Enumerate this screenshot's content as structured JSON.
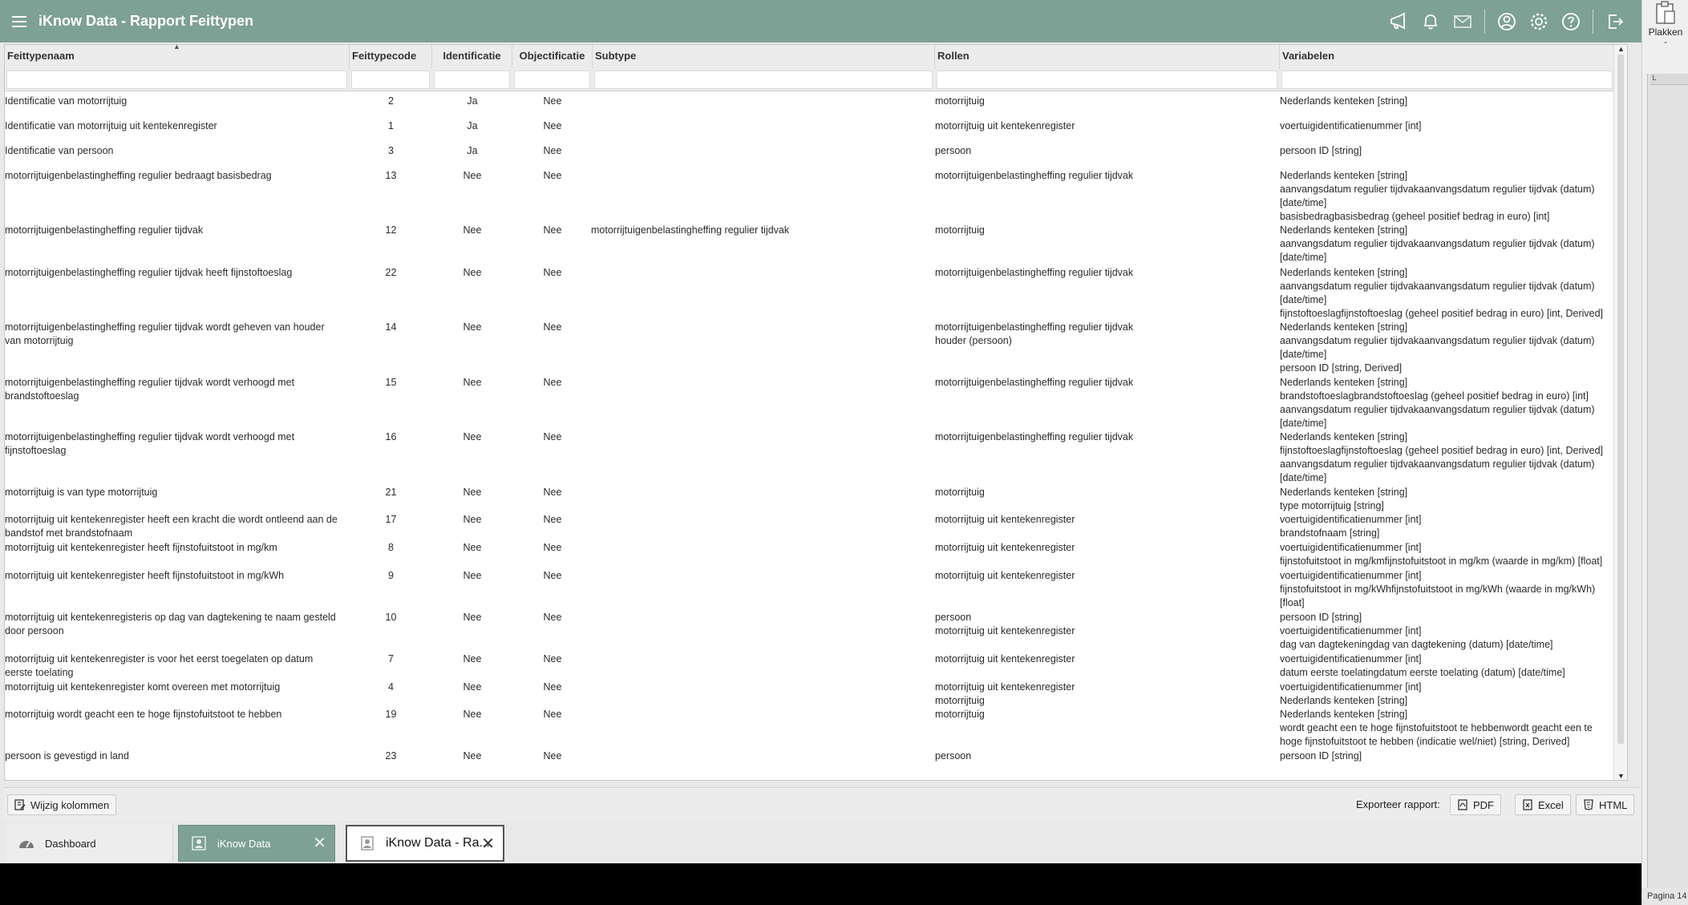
{
  "app": {
    "title": "iKnow Data - Rapport Feittypen"
  },
  "colors": {
    "accent": "#7da194"
  },
  "toolbar_icons": [
    "megaphone-icon",
    "bell-icon",
    "mail-icon",
    "user-icon",
    "gear-icon",
    "help-icon",
    "logout-icon"
  ],
  "table": {
    "columns": [
      "Feittypenaam",
      "Feittypecode",
      "Identificatie",
      "Objectificatie",
      "Subtype",
      "Rollen",
      "Variabelen"
    ],
    "rows": [
      {
        "name": [
          "Identificatie van motorrijtuig"
        ],
        "code": "2",
        "ident": "Ja",
        "obj": "Nee",
        "sub": [],
        "rol": [
          "motorrijtuig"
        ],
        "var": [
          "Nederlands kenteken [string]"
        ]
      },
      {
        "name": [
          "Identificatie van motorrijtuig uit kentekenregister"
        ],
        "code": "1",
        "ident": "Ja",
        "obj": "Nee",
        "sub": [],
        "rol": [
          "motorrijtuig uit kentekenregister"
        ],
        "var": [
          "voertuigidentificatienummer [int]"
        ]
      },
      {
        "name": [
          "Identificatie van persoon"
        ],
        "code": "3",
        "ident": "Ja",
        "obj": "Nee",
        "sub": [],
        "rol": [
          "persoon"
        ],
        "var": [
          "persoon ID [string]"
        ]
      },
      {
        "name": [
          "motorrijtuigenbelastingheffing regulier bedraagt basisbedrag"
        ],
        "code": "13",
        "ident": "Nee",
        "obj": "Nee",
        "sub": [],
        "rol": [
          "motorrijtuigenbelastingheffing regulier tijdvak"
        ],
        "var": [
          "Nederlands kenteken [string]",
          "aanvangsdatum regulier tijdvakaanvangsdatum regulier tijdvak (datum)",
          "[date/time]",
          "basisbedragbasisbedrag (geheel positief bedrag in euro) [int]"
        ]
      },
      {
        "name": [
          "motorrijtuigenbelastingheffing regulier tijdvak"
        ],
        "code": "12",
        "ident": "Nee",
        "obj": "Nee",
        "sub": [
          "motorrijtuigenbelastingheffing regulier tijdvak"
        ],
        "rol": [
          "motorrijtuig"
        ],
        "var": [
          "Nederlands kenteken [string]",
          "aanvangsdatum regulier tijdvakaanvangsdatum regulier tijdvak (datum)",
          "[date/time]"
        ]
      },
      {
        "name": [
          "motorrijtuigenbelastingheffing regulier tijdvak heeft fijnstoftoeslag"
        ],
        "code": "22",
        "ident": "Nee",
        "obj": "Nee",
        "sub": [],
        "rol": [
          "motorrijtuigenbelastingheffing regulier tijdvak"
        ],
        "var": [
          "Nederlands kenteken [string]",
          "aanvangsdatum regulier tijdvakaanvangsdatum regulier tijdvak (datum)",
          "[date/time]",
          "fijnstoftoeslagfijnstoftoeslag (geheel positief bedrag in euro) [int, Derived]"
        ]
      },
      {
        "name": [
          "motorrijtuigenbelastingheffing regulier tijdvak wordt geheven van houder",
          "van motorrijtuig"
        ],
        "code": "14",
        "ident": "Nee",
        "obj": "Nee",
        "sub": [],
        "rol": [
          "motorrijtuigenbelastingheffing regulier tijdvak",
          "houder (persoon)"
        ],
        "var": [
          "Nederlands kenteken [string]",
          "aanvangsdatum regulier tijdvakaanvangsdatum regulier tijdvak (datum)",
          "[date/time]",
          "persoon ID [string, Derived]"
        ]
      },
      {
        "name": [
          "motorrijtuigenbelastingheffing regulier tijdvak wordt verhoogd met",
          "brandstoftoeslag"
        ],
        "code": "15",
        "ident": "Nee",
        "obj": "Nee",
        "sub": [],
        "rol": [
          "motorrijtuigenbelastingheffing regulier tijdvak"
        ],
        "var": [
          "Nederlands kenteken [string]",
          "brandstoftoeslagbrandstoftoeslag (geheel positief bedrag in euro) [int]",
          "aanvangsdatum regulier tijdvakaanvangsdatum regulier tijdvak (datum)",
          "[date/time]"
        ]
      },
      {
        "name": [
          "motorrijtuigenbelastingheffing regulier tijdvak wordt verhoogd met",
          "fijnstoftoeslag"
        ],
        "code": "16",
        "ident": "Nee",
        "obj": "Nee",
        "sub": [],
        "rol": [
          "motorrijtuigenbelastingheffing regulier tijdvak"
        ],
        "var": [
          "Nederlands kenteken [string]",
          "fijnstoftoeslagfijnstoftoeslag (geheel positief bedrag in euro) [int, Derived]",
          "aanvangsdatum regulier tijdvakaanvangsdatum regulier tijdvak (datum)",
          "[date/time]"
        ]
      },
      {
        "name": [
          "motorrijtuig is van type motorrijtuig"
        ],
        "code": "21",
        "ident": "Nee",
        "obj": "Nee",
        "sub": [],
        "rol": [
          "motorrijtuig"
        ],
        "var": [
          "Nederlands kenteken [string]",
          "type motorrijtuig [string]"
        ]
      },
      {
        "name": [
          "motorrijtuig uit kentekenregister heeft een kracht die wordt ontleend aan de",
          "bandstof met brandstofnaam"
        ],
        "code": "17",
        "ident": "Nee",
        "obj": "Nee",
        "sub": [],
        "rol": [
          "motorrijtuig uit kentekenregister"
        ],
        "var": [
          "voertuigidentificatienummer [int]",
          "brandstofnaam [string]"
        ]
      },
      {
        "name": [
          "motorrijtuig uit kentekenregister heeft fijnstofuitstoot in mg/km"
        ],
        "code": "8",
        "ident": "Nee",
        "obj": "Nee",
        "sub": [],
        "rol": [
          "motorrijtuig uit kentekenregister"
        ],
        "var": [
          "voertuigidentificatienummer [int]",
          "fijnstofuitstoot in mg/kmfijnstofuitstoot in mg/km (waarde in mg/km) [float]"
        ]
      },
      {
        "name": [
          "motorrijtuig uit kentekenregister heeft fijnstofuitstoot in mg/kWh"
        ],
        "code": "9",
        "ident": "Nee",
        "obj": "Nee",
        "sub": [],
        "rol": [
          "motorrijtuig uit kentekenregister"
        ],
        "var": [
          "voertuigidentificatienummer [int]",
          "fijnstofuitstoot in mg/kWhfijnstofuitstoot in mg/kWh (waarde in mg/kWh)",
          "[float]"
        ]
      },
      {
        "name": [
          "motorrijtuig uit kentekenregisteris op dag van dagtekening te naam gesteld",
          "door persoon"
        ],
        "code": "10",
        "ident": "Nee",
        "obj": "Nee",
        "sub": [],
        "rol": [
          "persoon",
          "motorrijtuig uit kentekenregister"
        ],
        "var": [
          "persoon ID [string]",
          "voertuigidentificatienummer [int]",
          "dag van dagtekeningdag van dagtekening (datum) [date/time]"
        ]
      },
      {
        "name": [
          "motorrijtuig uit kentekenregister is voor het eerst toegelaten op datum",
          "eerste toelating"
        ],
        "code": "7",
        "ident": "Nee",
        "obj": "Nee",
        "sub": [],
        "rol": [
          "motorrijtuig uit kentekenregister"
        ],
        "var": [
          "voertuigidentificatienummer [int]",
          "datum eerste toelatingdatum eerste toelating (datum) [date/time]"
        ]
      },
      {
        "name": [
          "motorrijtuig uit kentekenregister komt overeen met motorrijtuig"
        ],
        "code": "4",
        "ident": "Nee",
        "obj": "Nee",
        "sub": [],
        "rol": [
          "motorrijtuig uit kentekenregister",
          "motorrijtuig"
        ],
        "var": [
          "voertuigidentificatienummer [int]",
          "Nederlands kenteken [string]"
        ]
      },
      {
        "name": [
          "motorrijtuig wordt geacht een te hoge fijnstofuitstoot te hebben"
        ],
        "code": "19",
        "ident": "Nee",
        "obj": "Nee",
        "sub": [],
        "rol": [
          "motorrijtuig"
        ],
        "var": [
          "Nederlands kenteken [string]",
          "wordt geacht een te hoge fijnstofuitstoot te hebbenwordt geacht een te",
          "hoge fijnstofuitstoot te hebben (indicatie wel/niet) [string, Derived]"
        ]
      },
      {
        "name": [
          "persoon is gevestigd in land"
        ],
        "code": "23",
        "ident": "Nee",
        "obj": "Nee",
        "sub": [],
        "rol": [
          "persoon"
        ],
        "var": [
          "persoon ID [string]"
        ]
      }
    ]
  },
  "footer": {
    "change_columns": "Wijzig kolommen",
    "export_label": "Exporteer rapport:",
    "pdf": "PDF",
    "excel": "Excel",
    "html": "HTML"
  },
  "tabs": [
    {
      "label": "Dashboard"
    },
    {
      "label": "iKnow Data"
    },
    {
      "label": "iKnow Data - Ra..."
    }
  ],
  "sidepanel": {
    "paste": "Plakken",
    "page": "Pagina 14"
  }
}
